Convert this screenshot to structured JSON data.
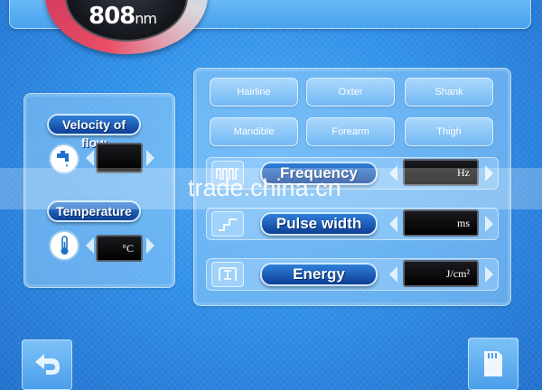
{
  "wavelength": {
    "value": "808",
    "unit": "nm"
  },
  "areas": [
    "Hairline",
    "Oxter",
    "Shank",
    "Mandible",
    "Forearm",
    "Thigh"
  ],
  "cooling": {
    "flow_label": "Velocity of flow",
    "flow_value": "",
    "temperature_label": "Temperature",
    "temperature_unit": "°C"
  },
  "params": {
    "frequency": {
      "label": "Frequency",
      "unit": "Hz"
    },
    "pulse_width": {
      "label": "Pulse width",
      "unit": "ms"
    },
    "energy": {
      "label": "Energy",
      "unit": "J/cm²"
    }
  },
  "watermark": "trade.china.cn",
  "icons": {
    "faucet": "faucet-icon",
    "thermometer": "thermometer-icon",
    "frequency": "pulse-train-icon",
    "pulse_width": "step-icon",
    "energy": "energy-icon",
    "back": "back-arrow-icon",
    "save": "sd-card-icon"
  },
  "colors": {
    "accent": "#e94e66",
    "background": "#2f8fe8",
    "label": "#0e3f96"
  }
}
